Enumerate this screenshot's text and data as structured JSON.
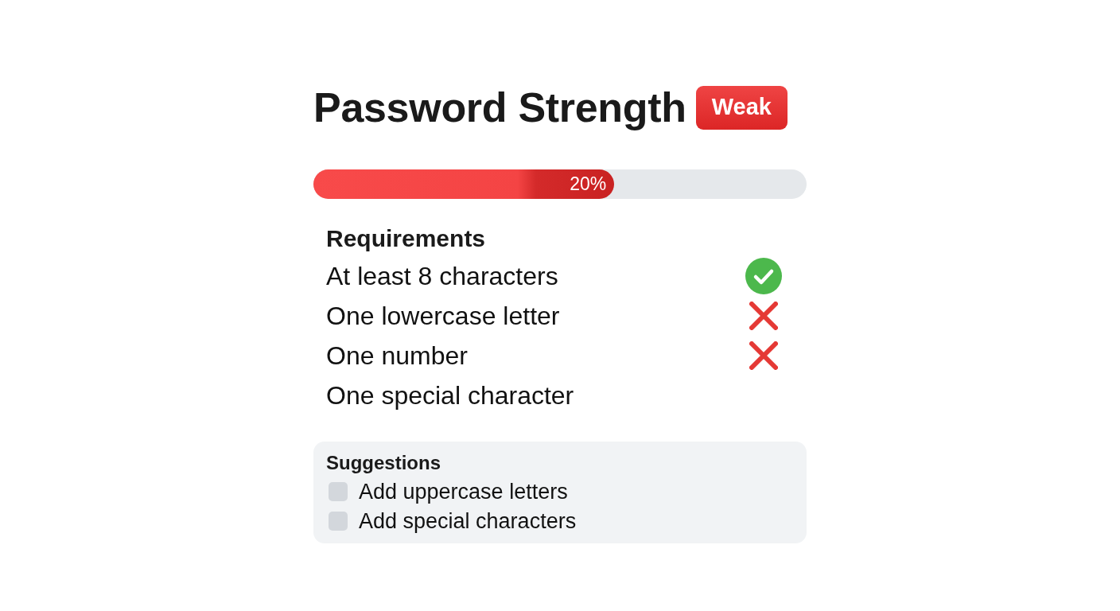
{
  "title": "Password Strength",
  "badge": "Weak",
  "progress": {
    "level": 0.61,
    "label": "20%"
  },
  "requirements": {
    "heading": "Requirements",
    "items": [
      {
        "text": "At least 8 characters",
        "met": true
      },
      {
        "text": "One lowercase letter",
        "met": false
      },
      {
        "text": "One number",
        "met": false
      },
      {
        "text": "One special character"
      }
    ]
  },
  "suggestions": {
    "heading": "Suggestions",
    "items": [
      {
        "text": "Add uppercase letters",
        "checked": false
      },
      {
        "text": "Add special characters",
        "checked": false
      }
    ]
  }
}
